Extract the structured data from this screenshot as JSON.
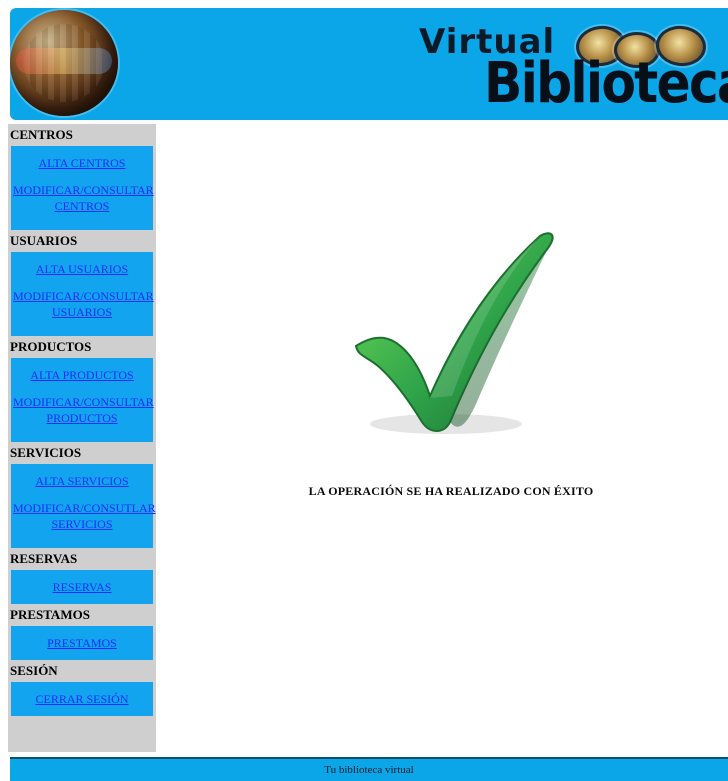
{
  "header": {
    "title_virtual": "Virtual",
    "title_biblioteca": "Biblioteca"
  },
  "sidebar": {
    "sections": [
      {
        "title": "CENTROS",
        "links": [
          "ALTA CENTROS",
          "MODIFICAR/CONSULTAR CENTROS"
        ]
      },
      {
        "title": "USUARIOS",
        "links": [
          "ALTA USUARIOS",
          "MODIFICAR/CONSULTAR USUARIOS"
        ]
      },
      {
        "title": "PRODUCTOS",
        "links": [
          "ALTA PRODUCTOS",
          "MODIFICAR/CONSULTAR PRODUCTOS"
        ]
      },
      {
        "title": "SERVICIOS",
        "links": [
          "ALTA SERVICIOS",
          "MODIFICAR/CONSUTLAR SERVICIOS"
        ]
      },
      {
        "title": "RESERVAS",
        "links": [
          "RESERVAS"
        ]
      },
      {
        "title": "PRESTAMOS",
        "links": [
          "PRESTAMOS"
        ]
      },
      {
        "title": "SESIÓN",
        "links": [
          "CERRAR SESIÓN"
        ]
      }
    ]
  },
  "main": {
    "success_message": "LA OPERACIÓN SE HA REALIZADO CON ÉXITO"
  },
  "footer": {
    "text": "Tu biblioteca virtual"
  },
  "colors": {
    "header_blue": "#0aa6e8",
    "menu_blue": "#12a4ef",
    "link_blue": "#1b2dff",
    "section_gray": "#cfcfcf",
    "check_green": "#2fa44a"
  },
  "icons": {
    "globe_logo": "globe-books-icon",
    "header_emblem": "library-emblem-icon",
    "success": "checkmark-icon"
  }
}
